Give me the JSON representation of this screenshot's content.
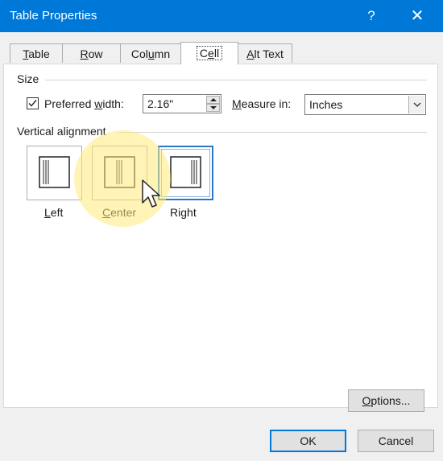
{
  "window": {
    "title": "Table Properties",
    "help_glyph": "?",
    "close_glyph": "✕"
  },
  "tabs": [
    {
      "label": "Table",
      "accel": "T"
    },
    {
      "label": "Row",
      "accel": "R"
    },
    {
      "label": "Column",
      "accel": "u"
    },
    {
      "label": "Cell",
      "accel": "e",
      "active": true
    },
    {
      "label": "Alt Text",
      "accel": "A"
    }
  ],
  "size": {
    "group_title": "Size",
    "preferred_width_label": "Preferred width:",
    "preferred_width_checked": true,
    "width_value": "2.16\"",
    "measure_label": "Measure in:",
    "measure_value": "Inches"
  },
  "vertical_alignment": {
    "group_title": "Vertical alignment",
    "options": [
      {
        "label": "Left",
        "icon": "align-top-icon"
      },
      {
        "label": "Center",
        "icon": "align-center-icon"
      },
      {
        "label": "Right",
        "icon": "align-bottom-icon",
        "selected": true
      }
    ]
  },
  "buttons": {
    "options": "Options...",
    "ok": "OK",
    "cancel": "Cancel"
  },
  "colors": {
    "titlebar": "#0078d7",
    "selected_border": "#2b78c7",
    "highlight": "#ffeb78"
  }
}
